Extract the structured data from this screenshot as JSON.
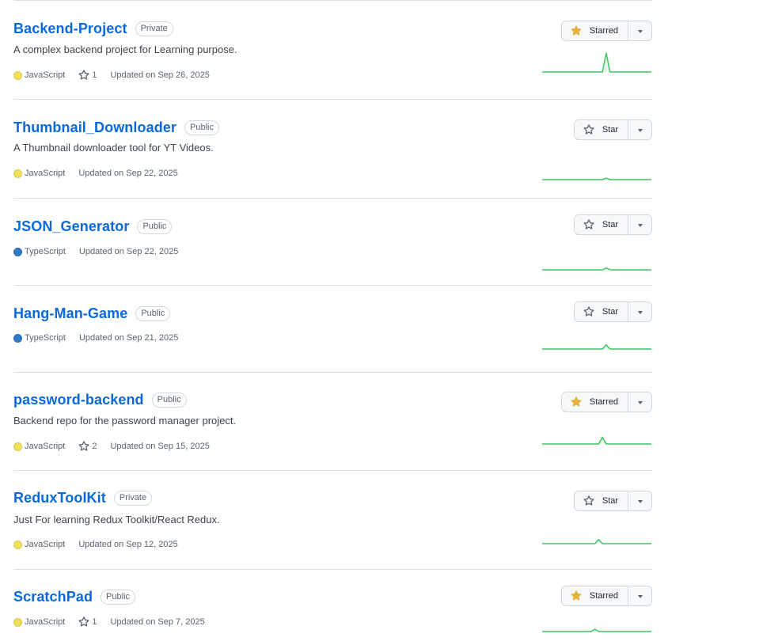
{
  "repos": [
    {
      "name": "Backend-Project",
      "visibility": "Private",
      "description": "A complex backend project for Learning purpose.",
      "language": "JavaScript",
      "language_color": "#f1e05a",
      "stars": "1",
      "updated": "Updated on Sep 26, 2025",
      "starred": true,
      "star_label": "Starred",
      "activity": [
        0,
        0,
        0,
        0,
        0,
        0,
        0,
        0,
        0,
        0,
        0,
        0,
        0,
        0,
        0,
        0,
        0,
        1,
        0,
        0,
        0,
        0,
        0,
        0,
        0,
        0,
        0,
        0,
        0,
        0
      ]
    },
    {
      "name": "Thumbnail_Downloader",
      "visibility": "Public",
      "description": "A Thumbnail downloader tool for YT Videos.",
      "language": "JavaScript",
      "language_color": "#f1e05a",
      "stars": "",
      "updated": "Updated on Sep 22, 2025",
      "starred": false,
      "star_label": "Star",
      "activity": [
        0,
        0,
        0,
        0,
        0,
        0,
        0,
        0,
        0,
        0,
        0,
        0,
        0,
        0,
        0,
        0,
        0,
        0.08,
        0,
        0,
        0,
        0,
        0,
        0,
        0,
        0,
        0,
        0,
        0,
        0
      ]
    },
    {
      "name": "JSON_Generator",
      "visibility": "Public",
      "description": "",
      "language": "TypeScript",
      "language_color": "#3178c6",
      "stars": "",
      "updated": "Updated on Sep 22, 2025",
      "starred": false,
      "star_label": "Star",
      "activity": [
        0,
        0,
        0,
        0,
        0,
        0,
        0,
        0,
        0,
        0,
        0,
        0,
        0,
        0,
        0,
        0,
        0,
        0.1,
        0,
        0,
        0,
        0,
        0,
        0,
        0,
        0,
        0,
        0,
        0,
        0
      ]
    },
    {
      "name": "Hang-Man-Game",
      "visibility": "Public",
      "description": "",
      "language": "TypeScript",
      "language_color": "#3178c6",
      "stars": "",
      "updated": "Updated on Sep 21, 2025",
      "starred": false,
      "star_label": "Star",
      "activity": [
        0,
        0,
        0,
        0,
        0,
        0,
        0,
        0,
        0,
        0,
        0,
        0,
        0,
        0,
        0,
        0,
        0,
        0.22,
        0,
        0,
        0,
        0,
        0,
        0,
        0,
        0,
        0,
        0,
        0,
        0
      ]
    },
    {
      "name": "password-backend",
      "visibility": "Public",
      "description": "Backend repo for the password manager project.",
      "language": "JavaScript",
      "language_color": "#f1e05a",
      "stars": "2",
      "updated": "Updated on Sep 15, 2025",
      "starred": true,
      "star_label": "Starred",
      "activity": [
        0,
        0,
        0,
        0,
        0,
        0,
        0,
        0,
        0,
        0,
        0,
        0,
        0,
        0,
        0,
        0,
        0.35,
        0,
        0,
        0,
        0,
        0,
        0,
        0,
        0,
        0,
        0,
        0,
        0,
        0
      ]
    },
    {
      "name": "ReduxToolKit",
      "visibility": "Private",
      "description": "Just For learning Redux Toolkit/React Redux.",
      "language": "JavaScript",
      "language_color": "#f1e05a",
      "stars": "",
      "updated": "Updated on Sep 12, 2025",
      "starred": false,
      "star_label": "Star",
      "activity": [
        0,
        0,
        0,
        0,
        0,
        0,
        0,
        0,
        0,
        0,
        0,
        0,
        0,
        0,
        0,
        0.22,
        0,
        0,
        0,
        0,
        0,
        0,
        0,
        0,
        0,
        0,
        0,
        0,
        0,
        0
      ]
    },
    {
      "name": "ScratchPad",
      "visibility": "Public",
      "description": "",
      "language": "JavaScript",
      "language_color": "#f1e05a",
      "stars": "1",
      "updated": "Updated on Sep 7, 2025",
      "starred": true,
      "star_label": "Starred",
      "activity": [
        0,
        0,
        0,
        0,
        0,
        0,
        0,
        0,
        0,
        0,
        0,
        0,
        0,
        0,
        0.12,
        0,
        0,
        0,
        0,
        0,
        0,
        0,
        0,
        0,
        0,
        0,
        0,
        0,
        0,
        0
      ]
    }
  ],
  "colors": {
    "link": "#0969da",
    "activity_line": "#40c463",
    "starred_star": "#e3b341"
  },
  "icons": {
    "star_outline": "star-icon",
    "star_filled": "star-filled-icon",
    "caret": "caret-down-icon"
  }
}
